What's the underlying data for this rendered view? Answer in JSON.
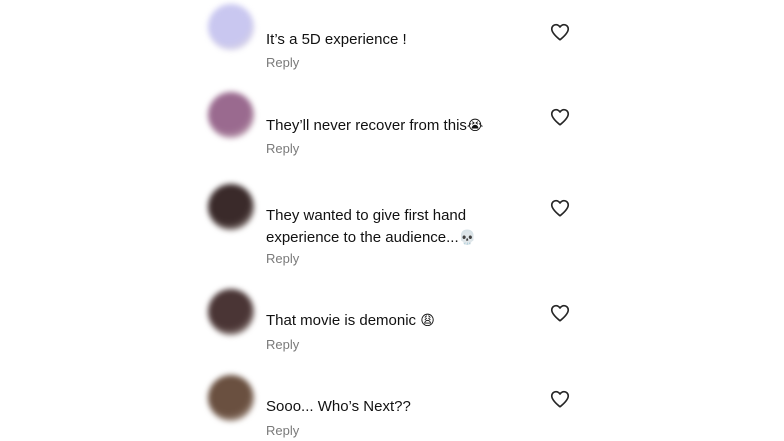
{
  "comments": [
    {
      "username": "",
      "time": "",
      "text": "It’s a 5D experience !",
      "emoji": "",
      "reply": "Reply",
      "avatar_color": "#c9c7f0"
    },
    {
      "username": "",
      "time": "",
      "text": "They’ll never recover from this",
      "emoji": "😭",
      "reply": "Reply",
      "avatar_color": "#9a6a8f"
    },
    {
      "username": "",
      "time": "",
      "text": "They wanted to give first hand experience to the audience...",
      "emoji": "💀",
      "reply": "Reply",
      "avatar_color": "#3a2a2a"
    },
    {
      "username": "",
      "time": "",
      "text": "That movie is demonic",
      "emoji": "😩",
      "reply": "Reply",
      "avatar_color": "#4a3535"
    },
    {
      "username": "",
      "time": "",
      "text": "Sooo... Who’s Next??",
      "emoji": "",
      "reply": "Reply",
      "avatar_color": "#6a5040"
    }
  ],
  "icons": {
    "avatar": "profile-avatar",
    "like": "heart-outline-icon"
  },
  "colors": {
    "background": "#ffffff",
    "text": "#111111",
    "reply": "#7a7a7a"
  }
}
